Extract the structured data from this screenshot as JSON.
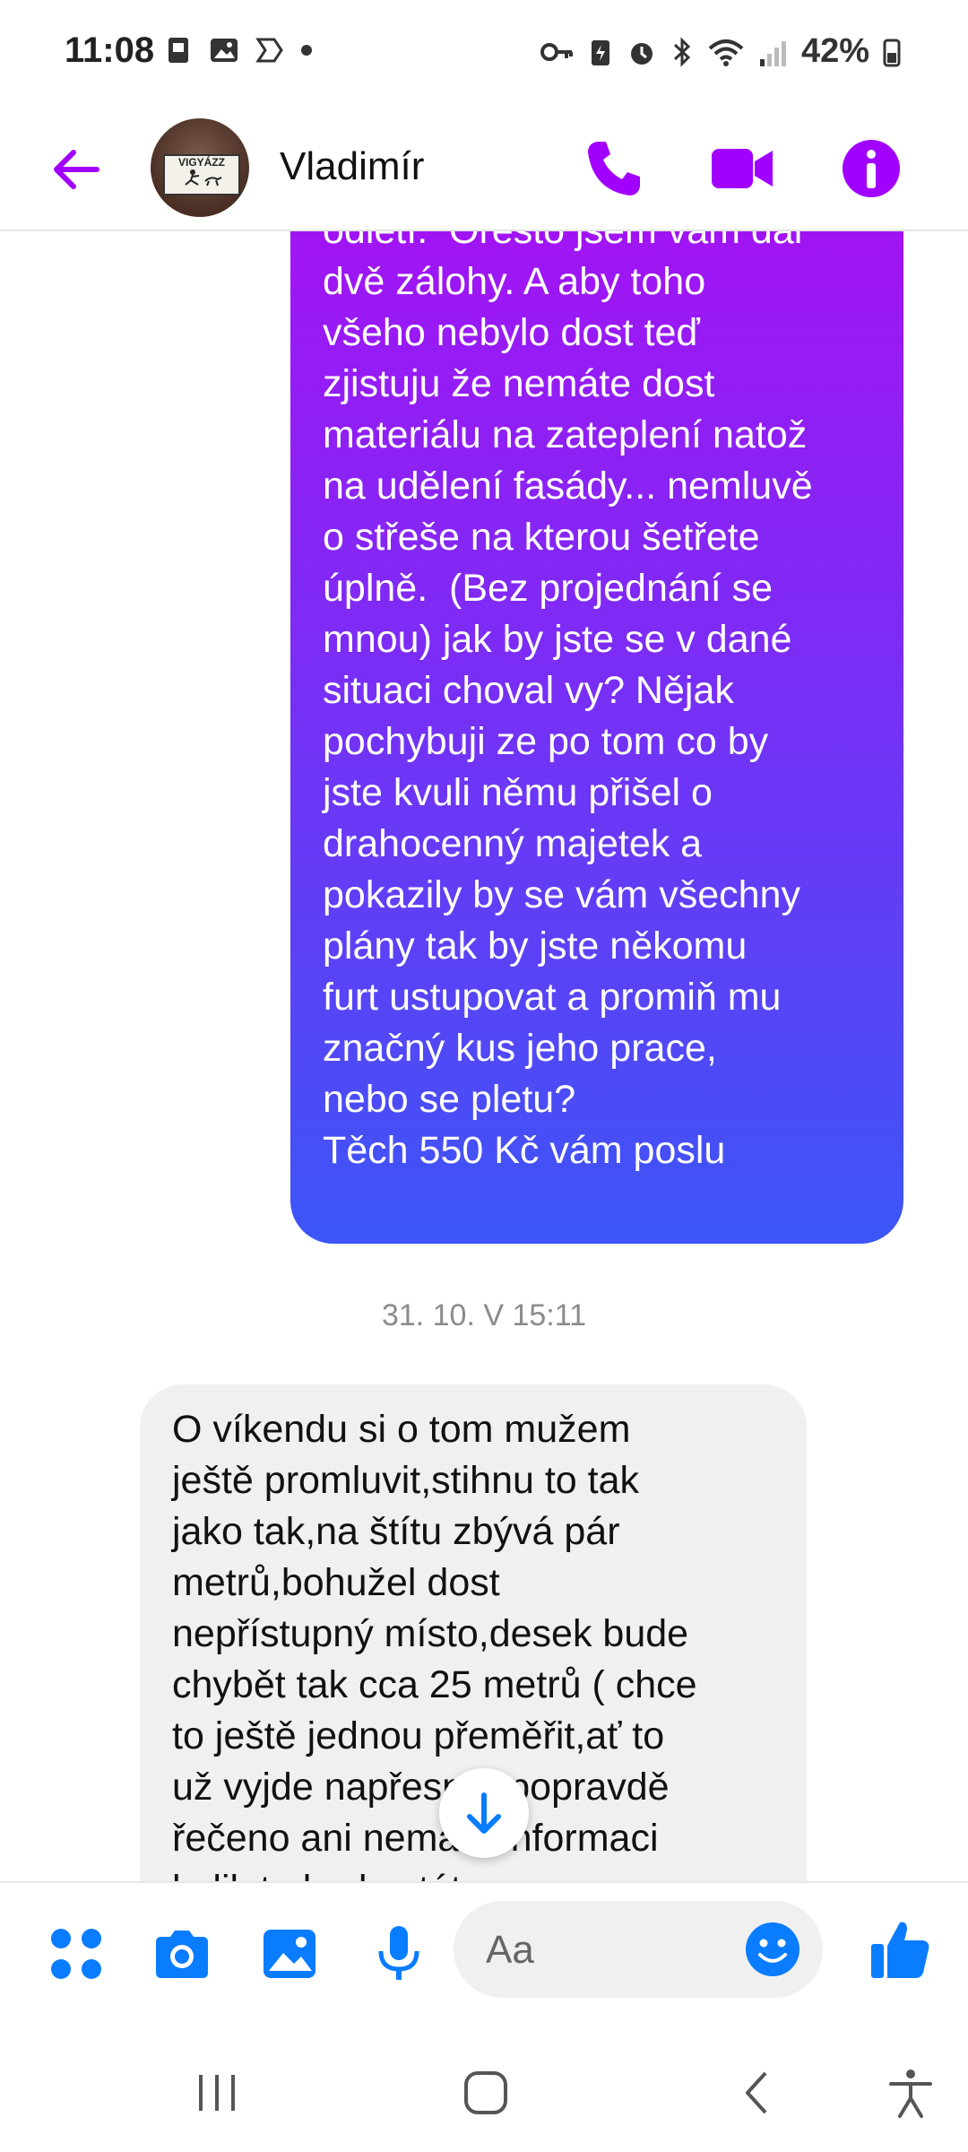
{
  "status_bar": {
    "time": "11:08",
    "battery": "42%",
    "left_icons": [
      "sim-icon",
      "gallery-icon",
      "app-icon",
      "dot-icon"
    ],
    "right_icons": [
      "key-icon",
      "battery-saver-icon",
      "alarm-icon",
      "bluetooth-icon",
      "wifi-icon",
      "signal-icon",
      "battery-icon"
    ]
  },
  "header": {
    "contact_name": "Vladimír",
    "avatar_sign_text": "VIGYÁZZ",
    "accent": "#a100ff"
  },
  "messages": {
    "outgoing_text": "vysoka šance že polystyren\nodletí.  Oresto jsem vam dal\ndvě zálohy. A aby toho\nvšeho nebylo dost teď\nzjistuju že nemáte dost\nmateriálu na zateplení natož\nna udělení fasády... nemluvě\no střeše na kterou šetřete\núplně.  (Bez projednání se\nmnou) jak by jste se v dané\nsituaci choval vy? Nějak\npochybuji ze po tom co by\njste kvuli němu přišel o\ndrahocenný majetek a\npokazily by se vám všechny\nplány tak by jste někomu\nfurt ustupovat a promiň mu\nznačný kus jeho prace,\nnebo se pletu?\nTěch 550 Kč vám poslu",
    "timestamp": "31. 10. V 15:11",
    "incoming_text": "O víkendu si o tom mužem\nještě promluvit,stihnu to tak\njako tak,na štítu zbývá pár\nmetrů,bohužel dost\nnepřístupný místo,desek bude\nchybět tak cca 25 metrů ( chce\nto ještě jednou přeměřit,ať to\nuž vyjde napřesno),popravdě\nřečeno ani nemám informaci\nkolik to bude stát"
  },
  "composer": {
    "placeholder": "Aa",
    "icons": [
      "apps-icon",
      "camera-icon",
      "gallery-icon",
      "microphone-icon",
      "emoji-icon",
      "thumbs-up-icon"
    ]
  },
  "colors": {
    "bubble_gradient_top": "#a710f3",
    "bubble_gradient_bottom": "#3c56f7",
    "composer_blue": "#0a7cff",
    "incoming_bubble": "#f0f0f0"
  }
}
